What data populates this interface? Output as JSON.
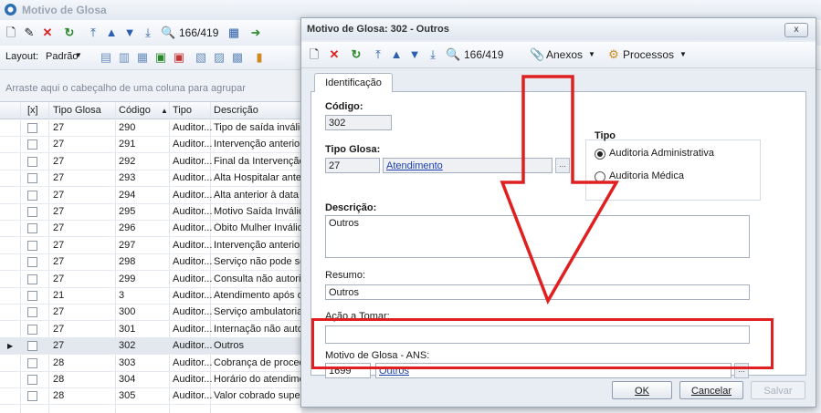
{
  "bg_window": {
    "title": "Motivo de Glosa",
    "counter": "166/419",
    "layout_label": "Layout:",
    "layout_value": "Padrão",
    "group_hint": "Arraste aqui o cabeçalho de uma coluna para agrupar",
    "columns": [
      "[x]",
      "Tipo Glosa",
      "Código",
      "Tipo",
      "Descrição"
    ],
    "rows": [
      {
        "tipo_glosa": "27",
        "codigo": "290",
        "tipo": "Auditor...",
        "descricao": "Tipo de saída inválid",
        "selected": false
      },
      {
        "tipo_glosa": "27",
        "codigo": "291",
        "tipo": "Auditor...",
        "descricao": "Intervenção anterior",
        "selected": false
      },
      {
        "tipo_glosa": "27",
        "codigo": "292",
        "tipo": "Auditor...",
        "descricao": "Final da Intervenção",
        "selected": false
      },
      {
        "tipo_glosa": "27",
        "codigo": "293",
        "tipo": "Auditor...",
        "descricao": "Alta Hospitalar anteri",
        "selected": false
      },
      {
        "tipo_glosa": "27",
        "codigo": "294",
        "tipo": "Auditor...",
        "descricao": "Alta anterior à data d",
        "selected": false
      },
      {
        "tipo_glosa": "27",
        "codigo": "295",
        "tipo": "Auditor...",
        "descricao": "Motivo Saída Inválido",
        "selected": false
      },
      {
        "tipo_glosa": "27",
        "codigo": "296",
        "tipo": "Auditor...",
        "descricao": "Óbito Mulher Inválido",
        "selected": false
      },
      {
        "tipo_glosa": "27",
        "codigo": "297",
        "tipo": "Auditor...",
        "descricao": "Intervenção anterior",
        "selected": false
      },
      {
        "tipo_glosa": "27",
        "codigo": "298",
        "tipo": "Auditor...",
        "descricao": "Serviço não pode ser",
        "selected": false
      },
      {
        "tipo_glosa": "27",
        "codigo": "299",
        "tipo": "Auditor...",
        "descricao": "Consulta não autoriza",
        "selected": false
      },
      {
        "tipo_glosa": "21",
        "codigo": "3",
        "tipo": "Auditor...",
        "descricao": "Atendimento após de",
        "selected": false
      },
      {
        "tipo_glosa": "27",
        "codigo": "300",
        "tipo": "Auditor...",
        "descricao": "Serviço ambulatorial r",
        "selected": false
      },
      {
        "tipo_glosa": "27",
        "codigo": "301",
        "tipo": "Auditor...",
        "descricao": "Internação não autor",
        "selected": false
      },
      {
        "tipo_glosa": "27",
        "codigo": "302",
        "tipo": "Auditor...",
        "descricao": "Outros",
        "selected": true
      },
      {
        "tipo_glosa": "28",
        "codigo": "303",
        "tipo": "Auditor...",
        "descricao": "Cobrança de procedir",
        "selected": false
      },
      {
        "tipo_glosa": "28",
        "codigo": "304",
        "tipo": "Auditor...",
        "descricao": "Horário do atendimen",
        "selected": false
      },
      {
        "tipo_glosa": "28",
        "codigo": "305",
        "tipo": "Auditor...",
        "descricao": "Valor cobrado superio",
        "selected": false
      }
    ]
  },
  "dialog": {
    "title": "Motivo de Glosa: 302 - Outros",
    "close_label": "x",
    "counter": "166/419",
    "anexos_label": "Anexos",
    "processos_label": "Processos",
    "tab_label": "Identificação",
    "codigo_label": "Código:",
    "codigo_value": "302",
    "tipo_glosa_label": "Tipo Glosa:",
    "tipo_glosa_code": "27",
    "tipo_glosa_link": "Atendimento",
    "tipo_label": "Tipo",
    "tipo_options": [
      "Auditoria Administrativa",
      "Auditoria Médica"
    ],
    "tipo_selected": "Auditoria Administrativa",
    "descricao_label": "Descrição:",
    "descricao_value": "Outros",
    "resumo_label": "Resumo:",
    "resumo_value": "Outros",
    "acao_label": "Ação a Tomar:",
    "acao_value": "",
    "ans_label": "Motivo de Glosa - ANS:",
    "ans_code": "1699",
    "ans_link": "Outros",
    "ellipsis": "...",
    "ok_label": "OK",
    "cancel_label": "Cancelar",
    "save_label": "Salvar"
  },
  "colors": {
    "highlight": "#e02020",
    "link": "#1a3fb0"
  }
}
